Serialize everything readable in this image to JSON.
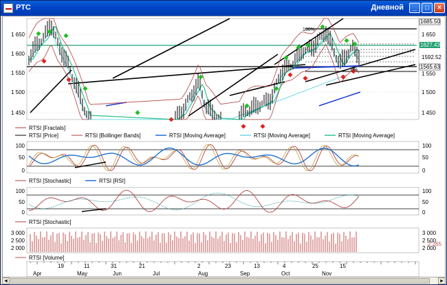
{
  "window": {
    "title": "РТС",
    "mode": "Дневной",
    "buttons": {
      "minimize": "_",
      "maximize": "□",
      "close": "×"
    }
  },
  "colors": {
    "price": "#000000",
    "bollinger": "#b04040",
    "ma_blue": "#1f6fd0",
    "ma_cyan": "#70d8e8",
    "ma_green": "#30c090",
    "fractal_up": "#20c020",
    "fractal_down": "#e02020",
    "stoch": "#b04040",
    "rsi": "#2070d0",
    "volume": "#c05050"
  },
  "panel1": {
    "y_ticks": [
      "1 650",
      "1 600",
      "1 550",
      "1 500",
      "1 450"
    ],
    "annotations": {
      "pct100": "100%",
      "pct0": "0%"
    },
    "right_labels": {
      "top": "1685.50",
      "green": "1627.43",
      "mid": "1592.52",
      "low": "1565.63"
    },
    "legend": [
      {
        "name": "RTSI [Fractals]",
        "color": "#c03030"
      },
      {
        "name": "RTSI [Price]",
        "color": "#000000"
      },
      {
        "name": "RTSI [Bollinger Bands]",
        "color": "#b04040"
      },
      {
        "name": "RTSI [Moving Average]",
        "color": "#1f6fd0"
      },
      {
        "name": "RTSI [Moving Average]",
        "color": "#70d8e8"
      },
      {
        "name": "RTSI [Moving Average]",
        "color": "#30c090"
      }
    ]
  },
  "panel2": {
    "y_ticks": [
      "100",
      "50",
      "0"
    ],
    "legend": [
      {
        "name": "RTSI [Stochastic]",
        "color": "#b04040"
      },
      {
        "name": "RTSI [RSI]",
        "color": "#2070d0"
      }
    ]
  },
  "panel3": {
    "y_ticks": [
      "100",
      "50",
      "0"
    ],
    "legend": [
      {
        "name": "RTSI [Stochastic]",
        "color": "#b04040"
      }
    ]
  },
  "panel4": {
    "y_ticks": [
      "3 000",
      "2 500",
      "2 000"
    ],
    "right_y_ticks": [
      "3 000",
      "2 500",
      "2 000"
    ],
    "last_value": "2 265",
    "legend": [
      {
        "name": "RTSI [Volume]",
        "color": "#c05050"
      }
    ]
  },
  "x_axis": {
    "days": [
      "19",
      "11",
      "31",
      "21",
      "2",
      "23",
      "13",
      "4",
      "25",
      "15"
    ],
    "months": [
      "Apr",
      "May",
      "Jun",
      "Jul",
      "Aug",
      "Sep",
      "Oct",
      "Nov"
    ]
  },
  "scrollbar": {
    "left": "◄",
    "right": "►"
  }
}
